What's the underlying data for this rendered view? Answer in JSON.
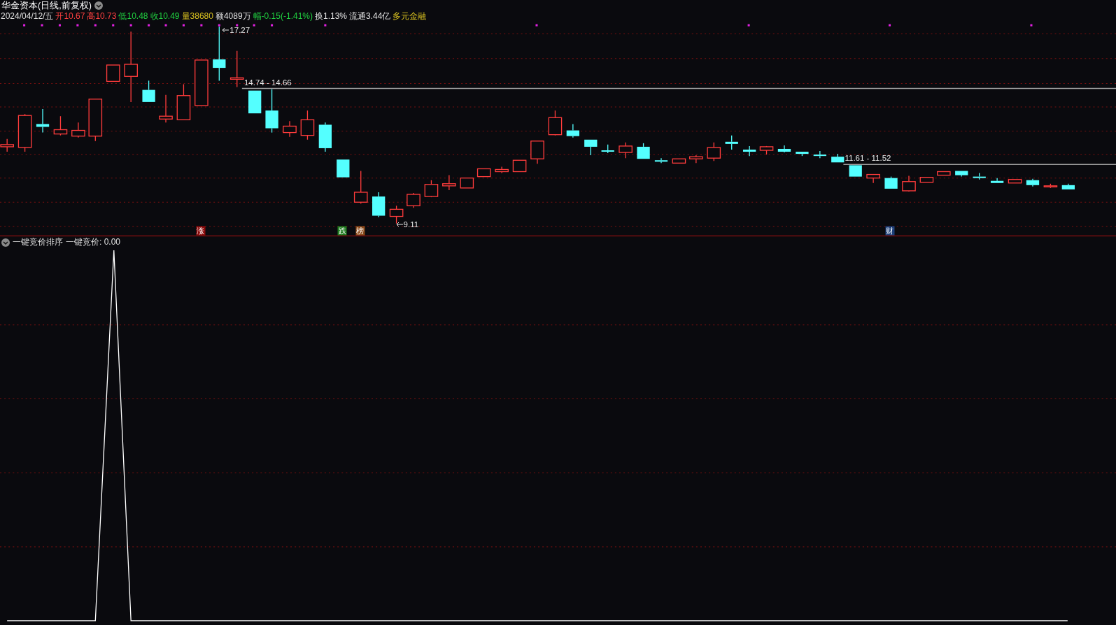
{
  "title": "华金资本(日线,前复权)",
  "quote": [
    {
      "text": "2024/04/12/五",
      "kind": "plain"
    },
    {
      "text": "开10.67",
      "kind": "up"
    },
    {
      "text": "高10.73",
      "kind": "up"
    },
    {
      "text": "低10.48",
      "kind": "down"
    },
    {
      "text": "收10.49",
      "kind": "down"
    },
    {
      "text": "量38680",
      "kind": "volume"
    },
    {
      "text": "额4089万",
      "kind": "plain"
    },
    {
      "text": "幅-0.15(-1.41%)",
      "kind": "down"
    },
    {
      "text": "换1.13%",
      "kind": "plain"
    },
    {
      "text": "流通3.44亿",
      "kind": "plain"
    },
    {
      "text": "多元金融",
      "kind": "sector"
    }
  ],
  "annotations": [
    {
      "text": "17.27",
      "kind": "high"
    },
    {
      "text": "14.74 - 14.66",
      "kind": "range_upper"
    },
    {
      "text": "11.61 - 11.52",
      "kind": "range_lower"
    },
    {
      "text": "9.11",
      "kind": "low"
    }
  ],
  "events": [
    {
      "text": "涨",
      "color": "#8b0a0a"
    },
    {
      "text": "跌",
      "color": "#1c7a1c"
    },
    {
      "text": "榜",
      "color": "#8b4a1a"
    },
    {
      "text": "财",
      "color": "#1c3f7a"
    }
  ],
  "indicator": {
    "name": "一键竞价排序",
    "reading": "一键竞价: 0.00"
  }
}
